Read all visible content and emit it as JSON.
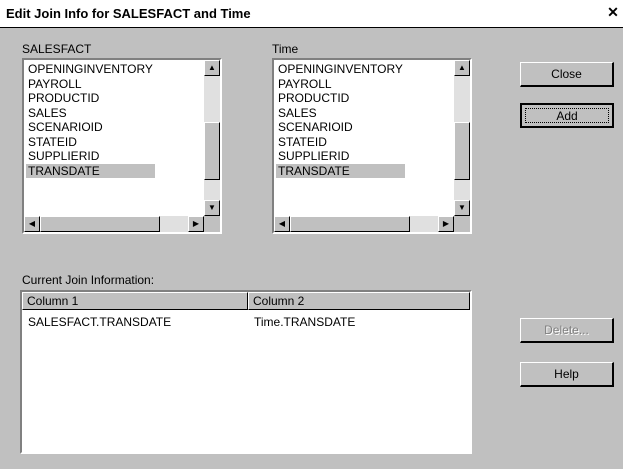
{
  "dialog": {
    "title": "Edit Join Info for SALESFACT and Time",
    "close_glyph": "✕"
  },
  "left_list": {
    "label": "SALESFACT",
    "items": [
      "OPENINGINVENTORY",
      "PAYROLL",
      "PRODUCTID",
      "SALES",
      "SCENARIOID",
      "STATEID",
      "SUPPLIERID",
      "TRANSDATE"
    ],
    "selected": "TRANSDATE"
  },
  "right_list": {
    "label": "Time",
    "items": [
      "OPENINGINVENTORY",
      "PAYROLL",
      "PRODUCTID",
      "SALES",
      "SCENARIOID",
      "STATEID",
      "SUPPLIERID",
      "TRANSDATE"
    ],
    "selected": "TRANSDATE"
  },
  "buttons": {
    "close": "Close",
    "add": "Add",
    "delete": "Delete...",
    "help": "Help"
  },
  "join": {
    "label": "Current Join Information:",
    "columns": [
      "Column 1",
      "Column 2"
    ],
    "rows": [
      [
        "SALESFACT.TRANSDATE",
        "Time.TRANSDATE"
      ]
    ]
  },
  "glyphs": {
    "up": "▲",
    "down": "▼",
    "left": "◀",
    "right": "▶"
  }
}
